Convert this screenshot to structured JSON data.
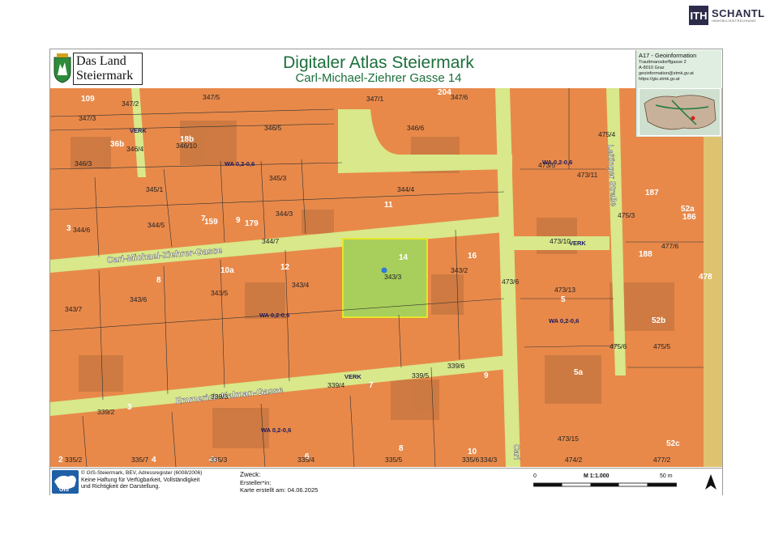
{
  "branding": {
    "agency_mark": "ITH",
    "agency_name": "SCHANTL",
    "agency_sub": "IMMOBILIENTREUHAND"
  },
  "header": {
    "land_line1": "Das Land",
    "land_line2": "Steiermark",
    "title": "Digitaler Atlas Steiermark",
    "subtitle": "Carl-Michael-Ziehrer Gasse 14",
    "info_title": "A17 - Geoinformation",
    "info_lines": [
      "Trauttmansdorffgasse 2",
      "A-8010 Graz",
      "geoinformation@stmk.gv.at",
      "https://gis.stmk.gv.at"
    ]
  },
  "map": {
    "streets": [
      "Carl-Michael-Ziehrer-Gasse",
      "Emmerich-Kalman-Gasse",
      "Leitinger Straße",
      "Carl"
    ],
    "zone_labels": [
      "WA 0,2-0,6",
      "WA 0,2-0,6",
      "WA 0,2-0,6",
      "WA 0,2-0,6",
      "WA 0,2-0,6"
    ],
    "verk_labels": [
      "VERK",
      "VERK",
      "VERK"
    ],
    "parcels": [
      "109",
      "347/2",
      "347/5",
      "347/1",
      "204",
      "347/6",
      "347/3",
      "346/5",
      "346/6",
      "36b",
      "346/4",
      "18b",
      "346/10",
      "346/3",
      "345/3",
      "345/1",
      "344/4",
      "344/5",
      "7",
      "159",
      "9",
      "179",
      "344/3",
      "11",
      "344/6",
      "3",
      "344/7",
      "10a",
      "12",
      "8",
      "343/5",
      "343/4",
      "343/6",
      "343/7",
      "343/3",
      "14",
      "16",
      "343/2",
      "473/6",
      "339/5",
      "339/6",
      "339/4",
      "7",
      "9",
      "339/3",
      "339/2",
      "3",
      "335/5",
      "8",
      "335/6",
      "10",
      "4a",
      "335/3",
      "6",
      "335/4",
      "335/7",
      "4",
      "2",
      "335/2",
      "334/3",
      "474/2",
      "473/5",
      "473/11",
      "475/4",
      "473/10",
      "475/3",
      "187",
      "186",
      "52a",
      "188",
      "477/6",
      "478",
      "5",
      "473/13",
      "52b",
      "475/5",
      "475/6",
      "5a",
      "473/15",
      "52c",
      "477/2"
    ]
  },
  "footer": {
    "copyright": "© GIS-Steiermark, BEV, Adressregister (6008/2006)",
    "disclaimer1": "Keine Haftung für Verfügbarkeit, Vollständigkeit",
    "disclaimer2": "und Richtigkeit der Darstellung.",
    "zweck_label": "Zweck:",
    "ersteller_label": "Ersteller*in:",
    "karte_erstellt": "Karte erstellt am: 04.06.2025",
    "scale_left": "0",
    "scale_mid": "M 1:1.000",
    "scale_right": "50 m",
    "gis_logo_text": "GIS"
  },
  "colors": {
    "zone_orange": "#e8894a",
    "road_green": "#d8e88a",
    "subject_parcel": "#a8cf5c",
    "title_green": "#1c6f3b"
  }
}
